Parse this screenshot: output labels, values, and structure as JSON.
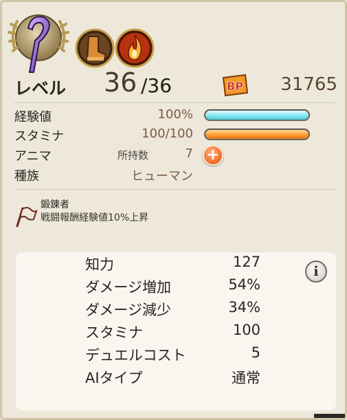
{
  "level": {
    "label": "レベル",
    "current": "36",
    "max": "/36"
  },
  "battle_points": {
    "icon": "bp-icon",
    "icon_text": "BP",
    "value": "31765"
  },
  "stats": {
    "experience": {
      "label": "経験値",
      "value": "100%",
      "progress": 1.0
    },
    "stamina": {
      "label": "スタミナ",
      "value": "100/100",
      "progress": 1.0
    },
    "anima": {
      "label": "アニマ",
      "owned_label": "所持数",
      "owned": "7",
      "add_icon": "plus-icon"
    },
    "race": {
      "label": "種族",
      "value": "ヒューマン"
    }
  },
  "skill": {
    "icon": "flag-icon",
    "name": "鍛錬者",
    "description": "戦闘報酬経験値10%上昇"
  },
  "details": [
    {
      "label": "知力",
      "value": "127"
    },
    {
      "label": "ダメージ増加",
      "value": "54%"
    },
    {
      "label": "ダメージ減少",
      "value": "34%"
    },
    {
      "label": "スタミナ",
      "value": "100"
    },
    {
      "label": "デュエルコスト",
      "value": "5"
    },
    {
      "label": "AIタイプ",
      "value": "通常"
    }
  ],
  "info_button": {
    "icon": "info-icon",
    "glyph": "i"
  },
  "colors": {
    "experience_bar": "#7fe4ef",
    "stamina_bar": "#ff9a2e",
    "accent": "#ef6a23"
  }
}
